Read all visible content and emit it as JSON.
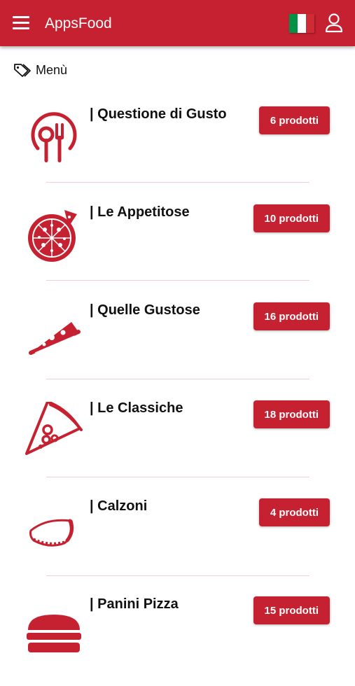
{
  "appbar": {
    "title": "AppsFood",
    "language": "Italiano",
    "flag_colors": [
      "#009246",
      "#ffffff",
      "#ce2b37"
    ]
  },
  "section": {
    "label": "Menù",
    "icon": "tag-icon"
  },
  "categories": [
    {
      "name": "| Questione di Gusto",
      "count": "6 prodotti",
      "icon": "plate-fork-icon"
    },
    {
      "name": "| Le Appetitose",
      "count": "10 prodotti",
      "icon": "whole-pizza-icon"
    },
    {
      "name": "| Quelle Gustose",
      "count": "16 prodotti",
      "icon": "pizza-slice-flat-icon"
    },
    {
      "name": "| Le Classiche",
      "count": "18 prodotti",
      "icon": "pizza-slice-icon"
    },
    {
      "name": "| Calzoni",
      "count": "4 prodotti",
      "icon": "calzone-icon"
    },
    {
      "name": "| Panini Pizza",
      "count": "15 prodotti",
      "icon": "burger-icon"
    }
  ],
  "colors": {
    "brand": "#c62131",
    "divider": "#f0cfd3"
  }
}
